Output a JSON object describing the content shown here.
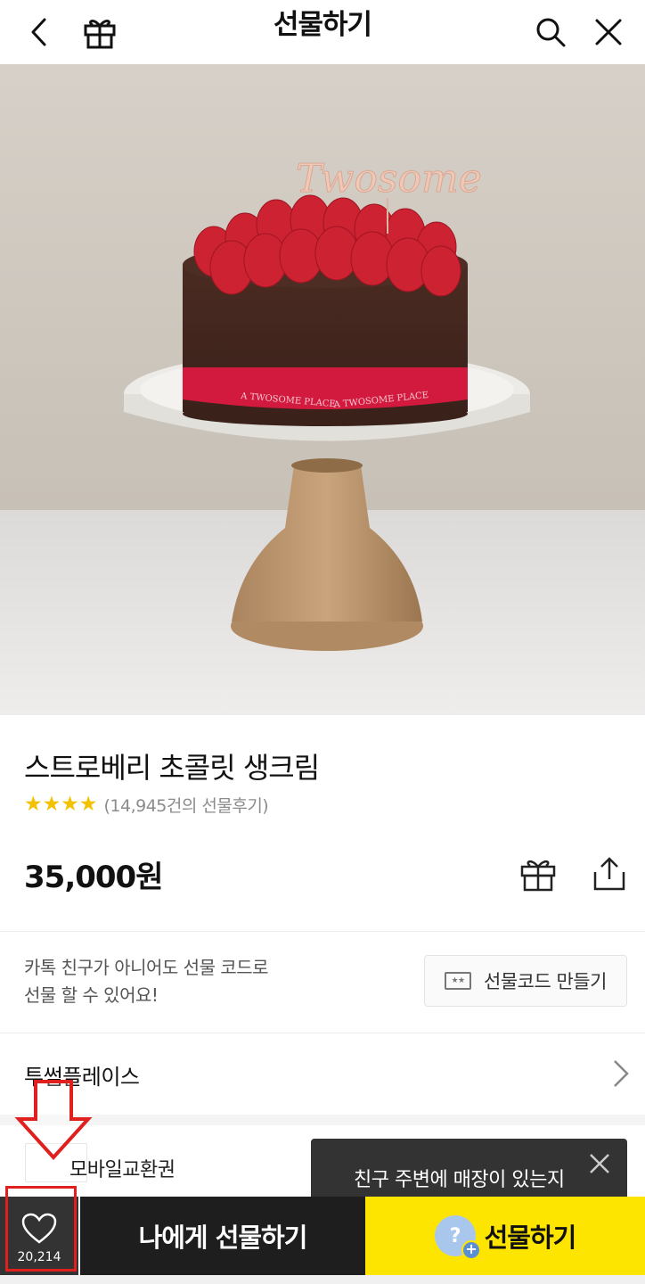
{
  "header": {
    "title": "선물하기",
    "icons": [
      "back-icon",
      "gift-box-icon",
      "search-icon",
      "close-icon"
    ]
  },
  "hero": {
    "topper_text": "Twosome",
    "ribbon_text": "A TWOSOME PLACE"
  },
  "product": {
    "name": "스트로베리 초콜릿 생크림",
    "stars": "★★★★",
    "review_text": "(14,945건의 선물후기)",
    "price": "35,000원"
  },
  "gift_code": {
    "line1": "카톡 친구가 아니어도 선물 코드로",
    "line2": "선물 할 수 있어요!",
    "button_label": "선물코드 만들기",
    "button_icon_text": "★★"
  },
  "brand": {
    "name": "투썸플레이스"
  },
  "category": {
    "label": "모바일교환권"
  },
  "tooltip": {
    "text": "친구 주변에 매장이 있는지"
  },
  "bottom_bar": {
    "like_count": "20,214",
    "self_gift_label": "나에게 선물하기",
    "gift_label": "선물하기",
    "gift_icon_text": "?"
  },
  "colors": {
    "accent_yellow": "#fee500",
    "dark_button": "#1e1e1e",
    "star": "#f2c200",
    "annotation_red": "#e0201f"
  }
}
